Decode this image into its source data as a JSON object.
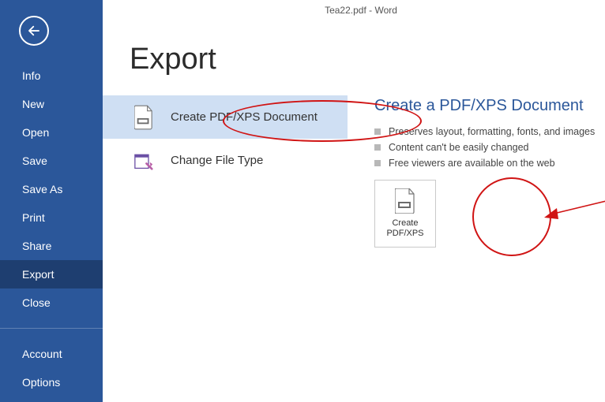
{
  "titlebar": "Tea22.pdf - Word",
  "page_title": "Export",
  "sidebar": {
    "items": [
      {
        "label": "Info"
      },
      {
        "label": "New"
      },
      {
        "label": "Open"
      },
      {
        "label": "Save"
      },
      {
        "label": "Save As"
      },
      {
        "label": "Print"
      },
      {
        "label": "Share"
      },
      {
        "label": "Export",
        "selected": true
      },
      {
        "label": "Close"
      }
    ],
    "footer": [
      {
        "label": "Account"
      },
      {
        "label": "Options"
      }
    ]
  },
  "options": [
    {
      "label": "Create PDF/XPS Document",
      "selected": true
    },
    {
      "label": "Change File Type"
    }
  ],
  "right": {
    "title": "Create a PDF/XPS Document",
    "bullets": [
      "Preserves layout, formatting, fonts, and images",
      "Content can't be easily changed",
      "Free viewers are available on the web"
    ],
    "button_line1": "Create",
    "button_line2": "PDF/XPS"
  },
  "colors": {
    "brand": "#2b579a",
    "annotation": "#d01414"
  }
}
